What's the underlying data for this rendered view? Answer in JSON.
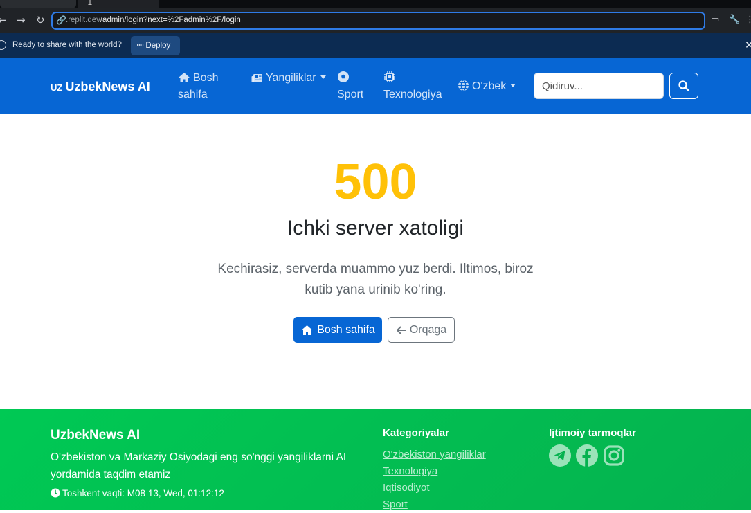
{
  "browser": {
    "tab_active_glyph": "1",
    "url_host": ".replit.dev",
    "url_path": "/admin/login?next=%2Fadmin%2F/login"
  },
  "replit": {
    "message": "Ready to share with the world?",
    "deploy_label": "Deploy"
  },
  "navbar": {
    "brand_prefix": "UZ",
    "brand_name": "UzbekNews AI",
    "links": [
      {
        "label": "Bosh",
        "label2": "sahifa",
        "icon": "home-icon"
      },
      {
        "label": "Yangiliklar",
        "icon": "newspaper-icon",
        "dropdown": true
      },
      {
        "label": "Sport",
        "icon": "soccer-ball-icon"
      },
      {
        "label": "Texnologiya",
        "icon": "chip-icon"
      },
      {
        "label": "O'zbek",
        "icon": "globe-icon",
        "dropdown": true
      }
    ],
    "search_placeholder": "Qidiruv..."
  },
  "error": {
    "code": "500",
    "title": "Ichki server xatoligi",
    "description": "Kechirasiz, serverda muammo yuz berdi. Iltimos, biroz kutib yana urinib ko'ring.",
    "home_button": "Bosh sahifa",
    "back_button": "Orqaga"
  },
  "footer": {
    "brand": "UzbekNews AI",
    "about": "O'zbekiston va Markaziy Osiyodagi eng so'nggi yangiliklarni AI yordamida taqdim etamiz",
    "time": "Toshkent vaqti: M08 13, Wed, 01:12:12",
    "categories_title": "Kategoriyalar",
    "categories": [
      "O'zbekiston yangiliklar",
      "Texnologiya",
      "Iqtisodiyot",
      "Sport"
    ],
    "social_title": "Ijtimoiy tarmoqlar",
    "social": [
      "telegram-icon",
      "facebook-icon",
      "instagram-icon"
    ]
  },
  "colors": {
    "navbar": "#0766d4",
    "error_code": "#ffc107",
    "footer": "#00c954",
    "primary_button": "#0766d4"
  }
}
